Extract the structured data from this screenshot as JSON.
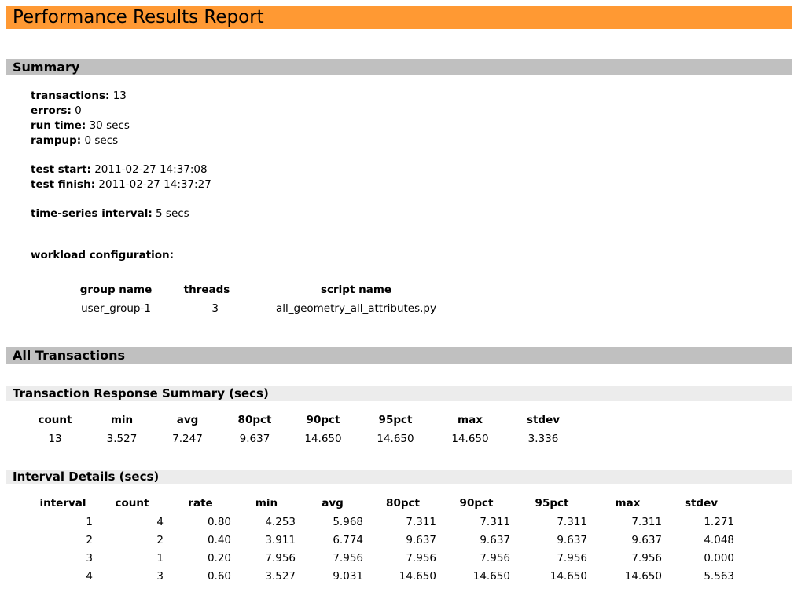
{
  "title": "Performance Results Report",
  "summary": {
    "heading": "Summary",
    "transactions_label": "transactions",
    "transactions": "13",
    "errors_label": "errors",
    "errors": "0",
    "run_time_label": "run time",
    "run_time": "30 secs",
    "rampup_label": "rampup",
    "rampup": "0 secs",
    "test_start_label": "test start",
    "test_start": "2011-02-27 14:37:08",
    "test_finish_label": "test finish",
    "test_finish": "2011-02-27 14:37:27",
    "interval_label": "time-series interval",
    "interval": "5 secs",
    "workload_label": "workload configuration:",
    "workload": {
      "headers": [
        "group name",
        "threads",
        "script name"
      ],
      "rows": [
        [
          "user_group-1",
          "3",
          "all_geometry_all_attributes.py"
        ]
      ]
    }
  },
  "all_transactions": {
    "heading": "All Transactions",
    "response_summary": {
      "heading": "Transaction Response Summary (secs)",
      "headers": [
        "count",
        "min",
        "avg",
        "80pct",
        "90pct",
        "95pct",
        "max",
        "stdev"
      ],
      "row": [
        "13",
        "3.527",
        "7.247",
        "9.637",
        "14.650",
        "14.650",
        "14.650",
        "3.336"
      ]
    },
    "interval_details": {
      "heading": "Interval Details (secs)",
      "headers": [
        "interval",
        "count",
        "rate",
        "min",
        "avg",
        "80pct",
        "90pct",
        "95pct",
        "max",
        "stdev"
      ],
      "rows": [
        [
          "1",
          "4",
          "0.80",
          "4.253",
          "5.968",
          "7.311",
          "7.311",
          "7.311",
          "7.311",
          "1.271"
        ],
        [
          "2",
          "2",
          "0.40",
          "3.911",
          "6.774",
          "9.637",
          "9.637",
          "9.637",
          "9.637",
          "4.048"
        ],
        [
          "3",
          "1",
          "0.20",
          "7.956",
          "7.956",
          "7.956",
          "7.956",
          "7.956",
          "7.956",
          "0.000"
        ],
        [
          "4",
          "3",
          "0.60",
          "3.527",
          "9.031",
          "14.650",
          "14.650",
          "14.650",
          "14.650",
          "5.563"
        ]
      ]
    }
  }
}
